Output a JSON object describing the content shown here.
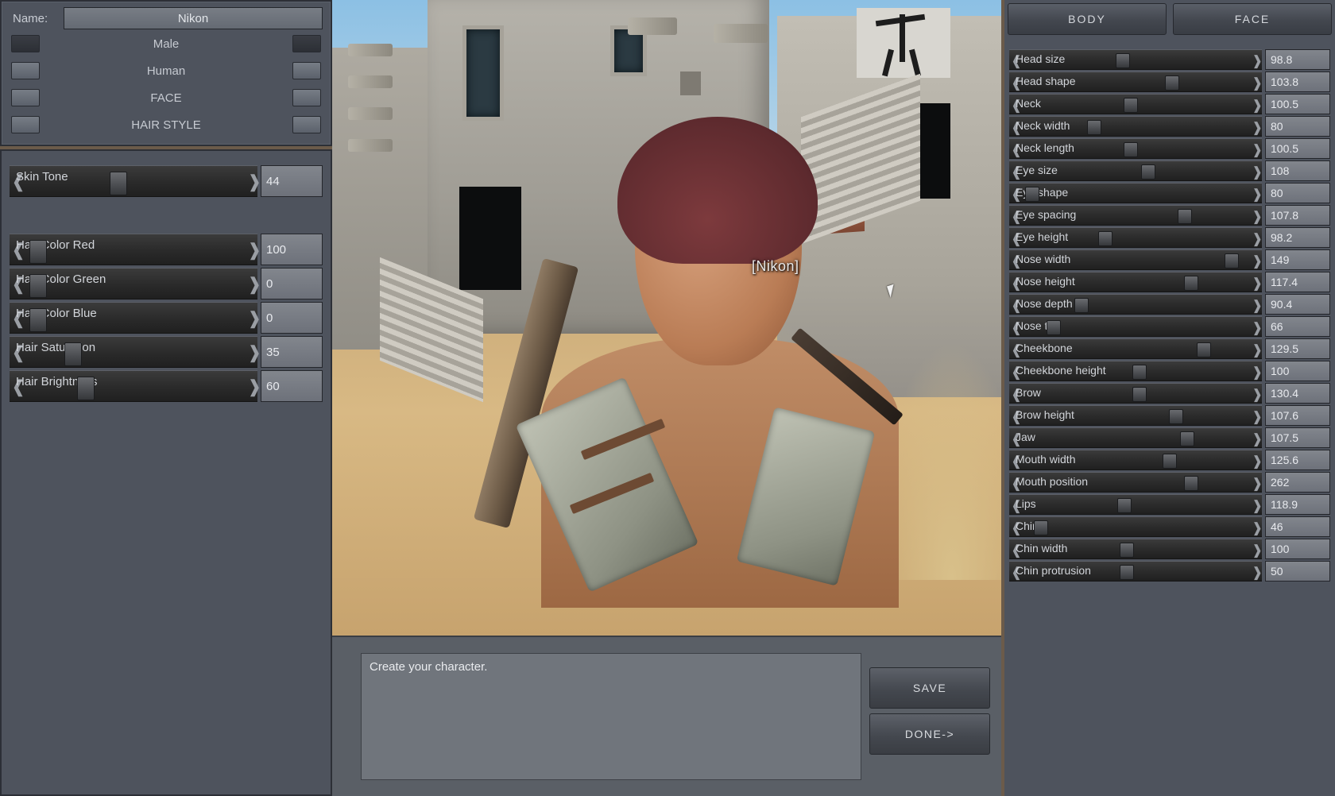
{
  "viewport": {
    "character_name_tag": "[Nikon]"
  },
  "identity": {
    "name_label": "Name:",
    "name_value": "Nikon",
    "options": [
      {
        "label": "Male"
      },
      {
        "label": "Human"
      },
      {
        "label": "FACE"
      },
      {
        "label": "HAIR STYLE"
      }
    ]
  },
  "appearance_sliders": [
    {
      "label": "Skin Tone",
      "value": "44",
      "percent": 44
    },
    {
      "label": "Hair Color Red",
      "value": "100",
      "percent": 5
    },
    {
      "label": "Hair Color Green",
      "value": "0",
      "percent": 5
    },
    {
      "label": "Hair Color Blue",
      "value": "0",
      "percent": 5
    },
    {
      "label": "Hair Saturation",
      "value": "35",
      "percent": 22
    },
    {
      "label": "Hair Brightness",
      "value": "60",
      "percent": 28
    }
  ],
  "right_panel": {
    "tabs": [
      {
        "label": "BODY",
        "active": true
      },
      {
        "label": "FACE",
        "active": false
      }
    ],
    "sliders": [
      {
        "label": "Head size",
        "value": "98.8",
        "percent": 45
      },
      {
        "label": "Head shape",
        "value": "103.8",
        "percent": 68
      },
      {
        "label": "Neck",
        "value": "100.5",
        "percent": 49
      },
      {
        "label": "Neck width",
        "value": "80",
        "percent": 32
      },
      {
        "label": "Neck length",
        "value": "100.5",
        "percent": 49
      },
      {
        "label": "Eye size",
        "value": "108",
        "percent": 57
      },
      {
        "label": "Eye shape",
        "value": "80",
        "percent": 3
      },
      {
        "label": "Eye spacing",
        "value": "107.8",
        "percent": 74
      },
      {
        "label": "Eye height",
        "value": "98.2",
        "percent": 37
      },
      {
        "label": "Nose width",
        "value": "149",
        "percent": 96
      },
      {
        "label": "Nose height",
        "value": "117.4",
        "percent": 77
      },
      {
        "label": "Nose depth",
        "value": "90.4",
        "percent": 26
      },
      {
        "label": "Nose tip",
        "value": "66",
        "percent": 13
      },
      {
        "label": "Cheekbone",
        "value": "129.5",
        "percent": 83
      },
      {
        "label": "Cheekbone height",
        "value": "100",
        "percent": 53
      },
      {
        "label": "Brow",
        "value": "130.4",
        "percent": 53
      },
      {
        "label": "Brow height",
        "value": "107.6",
        "percent": 70
      },
      {
        "label": "Jaw",
        "value": "107.5",
        "percent": 75
      },
      {
        "label": "Mouth width",
        "value": "125.6",
        "percent": 67
      },
      {
        "label": "Mouth position",
        "value": "262",
        "percent": 77
      },
      {
        "label": "Lips",
        "value": "118.9",
        "percent": 46
      },
      {
        "label": "Chin",
        "value": "46",
        "percent": 7
      },
      {
        "label": "Chin width",
        "value": "100",
        "percent": 47
      },
      {
        "label": "Chin protrusion",
        "value": "50",
        "percent": 47
      }
    ]
  },
  "dialog": {
    "message": "Create your character.",
    "save_label": "SAVE",
    "done_label": "DONE->"
  },
  "colors": {
    "panel_bg": "#4e535d",
    "track_bg": "#2a2a2a",
    "value_bg": "#767a82",
    "text": "#d2d5da"
  }
}
